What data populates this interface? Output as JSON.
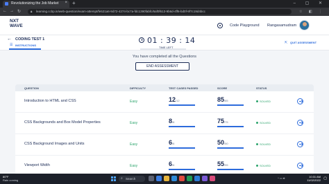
{
  "browser": {
    "tab_title": "Revolutionizing the Job Market",
    "tab_close": "×",
    "new_tab": "+",
    "url": "learning.ccbp.in/web-question/exam-attempt/fe521a6-9d72-4274-bc7a-fdc1390fabfc/6af0f613-9b6d-4ff6-bd0f-9f7c19d4bcc",
    "window_controls": "–  ▢  ✕"
  },
  "header": {
    "logo_line1": "NXT",
    "logo_line2": "WAVE",
    "playground_label": "Code Playground",
    "user_name": "Rangasamudram"
  },
  "testbar": {
    "back": "←",
    "title": "CODING TEST 1",
    "instructions": "INSTRUCTIONS",
    "timer": "01 : 39 : 14",
    "time_left": "TIME LEFT",
    "quit": "QUIT ASSESSMENT"
  },
  "main": {
    "completed_message": "You have completed all the Questions",
    "end_button": "END ASSESSMENT"
  },
  "table": {
    "headers": {
      "question": "QUESTION",
      "difficulty": "DIFFICULTY",
      "test_cases": "TEST CASES PASSED",
      "score": "SCORE",
      "status": "STATUS"
    },
    "rows": [
      {
        "question": "Introduction to HTML and CSS",
        "difficulty": "Easy",
        "tc_passed": "12",
        "tc_total": "/12",
        "tc_fraction": 1.0,
        "score": "85",
        "score_total": "/85",
        "score_fraction": 1.0,
        "status": "SOLVED"
      },
      {
        "question": "CSS Backgrounds and Box Model Properties",
        "difficulty": "Easy",
        "tc_passed": "8",
        "tc_total": "/8",
        "tc_fraction": 1.0,
        "score": "75",
        "score_total": "/75",
        "score_fraction": 1.0,
        "status": "SOLVED"
      },
      {
        "question": "CSS Background Images and Units",
        "difficulty": "Easy",
        "tc_passed": "6",
        "tc_total": "/6",
        "tc_fraction": 1.0,
        "score": "50",
        "score_total": "/50",
        "score_fraction": 1.0,
        "status": "SOLVED"
      },
      {
        "question": "Viewport Width",
        "difficulty": "Easy",
        "tc_passed": "6",
        "tc_total": "/6",
        "tc_fraction": 1.0,
        "score": "55",
        "score_total": "/55",
        "score_fraction": 1.0,
        "status": "SOLVED"
      }
    ]
  },
  "taskbar": {
    "weather_temp": "80°F",
    "weather_desc": "Rain coming",
    "search_label": "Search",
    "time": "10:31 AM",
    "date": "11/02/2022"
  },
  "colors": {
    "accent": "#2c6bdc",
    "success": "#2ba36b",
    "navy": "#1b2b55"
  }
}
